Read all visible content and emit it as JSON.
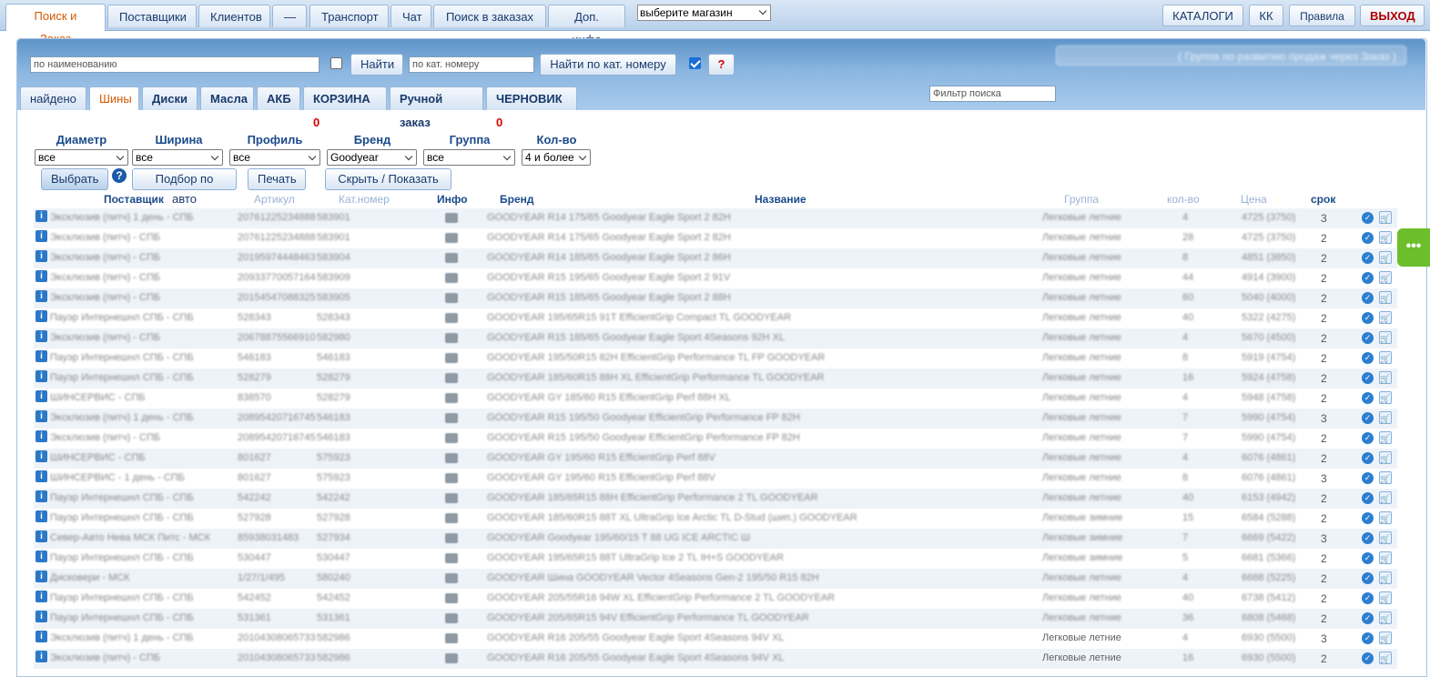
{
  "topnav": {
    "tabs": [
      "Поиск и Заказ",
      "Поставщики",
      "Клиентов",
      "—",
      "Транспорт",
      "Чат",
      "Поиск в заказах",
      "Доп. инфо"
    ],
    "store_select": "выберите магазин",
    "right_buttons": [
      "КАТАЛОГИ",
      "КК",
      "Правила"
    ],
    "exit": "ВЫХОД"
  },
  "search": {
    "name_placeholder": "по наименованию",
    "find_label": "Найти",
    "catno_placeholder": "по кат. номеру",
    "find_catno_label": "Найти по кат. номеру",
    "help_label": "?",
    "blurred_note": "( Группа по развитию продаж через Заказ )",
    "filter_placeholder": "Фильтр поиска"
  },
  "subtabs": {
    "found": "найдено",
    "tires": "Шины",
    "disks": "Диски",
    "oils": "Масла",
    "akb": "АКБ",
    "cart": "КОРЗИНА",
    "cart_count": "0",
    "manual": "Ручной заказ",
    "draft": "ЧЕРНОВИК",
    "draft_count": "0"
  },
  "filters": {
    "diameter": {
      "label": "Диаметр",
      "value": "все"
    },
    "width": {
      "label": "Ширина",
      "value": "все"
    },
    "profile": {
      "label": "Профиль",
      "value": "все"
    },
    "brand": {
      "label": "Бренд",
      "value": "Goodyear"
    },
    "group": {
      "label": "Группа",
      "value": "все"
    },
    "qty": {
      "label": "Кол-во",
      "value": "4 и более"
    },
    "select_button": "Выбрать",
    "auto_button": "Подбор по авто",
    "print_button": "Печать",
    "toggle_button": "Скрыть / Показать"
  },
  "table": {
    "headers": {
      "supplier": "Поставщик",
      "article": "Артикул",
      "catno": "Кат.номер",
      "info": "Инфо",
      "brand": "Бренд",
      "name": "Название",
      "group": "Группа",
      "qty": "кол-во",
      "price": "Цена",
      "srok": "срок"
    },
    "rows": [
      {
        "supplier": "Эксклюзив (питч) 1 день - СПБ",
        "article": "20761225234888",
        "catno": "583901",
        "name": "GOODYEAR R14 175/65 Goodyear Eagle Sport 2 82H",
        "group": "Легковые летние",
        "qty": "4",
        "price": "4725 (3750)",
        "srok": "3"
      },
      {
        "supplier": "Эксклюзив (питч) - СПБ",
        "article": "20761225234888",
        "catno": "583901",
        "name": "GOODYEAR R14 175/65 Goodyear Eagle Sport 2 82H",
        "group": "Легковые летние",
        "qty": "28",
        "price": "4725 (3750)",
        "srok": "2"
      },
      {
        "supplier": "Эксклюзив (питч) - СПБ",
        "article": "20195974448463",
        "catno": "583904",
        "name": "GOODYEAR R14 185/65 Goodyear Eagle Sport 2 86H",
        "group": "Легковые летние",
        "qty": "8",
        "price": "4851 (3850)",
        "srok": "2"
      },
      {
        "supplier": "Эксклюзив (питч) - СПБ",
        "article": "20933770057164",
        "catno": "583909",
        "name": "GOODYEAR R15 195/65 Goodyear Eagle Sport 2 91V",
        "group": "Легковые летние",
        "qty": "44",
        "price": "4914 (3900)",
        "srok": "2"
      },
      {
        "supplier": "Эксклюзив (питч) - СПБ",
        "article": "20154547088325",
        "catno": "583905",
        "name": "GOODYEAR R15 185/65 Goodyear Eagle Sport 2 88H",
        "group": "Легковые летние",
        "qty": "60",
        "price": "5040 (4000)",
        "srok": "2"
      },
      {
        "supplier": "Пауэр Интернешнл СПБ - СПБ",
        "article": "528343",
        "catno": "528343",
        "name": "GOODYEAR 195/65R15 91T EfficientGrip Compact TL GOODYEAR",
        "group": "Легковые летние",
        "qty": "40",
        "price": "5322 (4275)",
        "srok": "2"
      },
      {
        "supplier": "Эксклюзив (питч) - СПБ",
        "article": "20678875566910",
        "catno": "582980",
        "name": "GOODYEAR R15 185/65 Goodyear Eagle Sport 4Seasons 92H XL",
        "group": "Легковые летние",
        "qty": "4",
        "price": "5670 (4500)",
        "srok": "2"
      },
      {
        "supplier": "Пауэр Интернешнл СПБ - СПБ",
        "article": "546183",
        "catno": "546183",
        "name": "GOODYEAR 195/50R15 82H EfficientGrip Performance TL FP GOODYEAR",
        "group": "Легковые летние",
        "qty": "8",
        "price": "5919 (4754)",
        "srok": "2"
      },
      {
        "supplier": "Пауэр Интернешнл СПБ - СПБ",
        "article": "528279",
        "catno": "528279",
        "name": "GOODYEAR 185/60R15 88H XL EfficientGrip Performance TL GOODYEAR",
        "group": "Легковые летние",
        "qty": "16",
        "price": "5924 (4758)",
        "srok": "2"
      },
      {
        "supplier": "ШИНСЕРВИС - СПБ",
        "article": "838570",
        "catno": "528279",
        "name": "GOODYEAR GY 185/60 R15 EfficientGrip Perf 88H XL",
        "group": "Легковые летние",
        "qty": "4",
        "price": "5948 (4758)",
        "srok": "2"
      },
      {
        "supplier": "Эксклюзив (питч) 1 день - СПБ",
        "article": "20895420716745",
        "catno": "546183",
        "name": "GOODYEAR R15 195/50 Goodyear EfficientGrip Performance FP 82H",
        "group": "Легковые летние",
        "qty": "7",
        "price": "5990 (4754)",
        "srok": "3"
      },
      {
        "supplier": "Эксклюзив (питч) - СПБ",
        "article": "20895420716745",
        "catno": "546183",
        "name": "GOODYEAR R15 195/50 Goodyear EfficientGrip Performance FP 82H",
        "group": "Легковые летние",
        "qty": "7",
        "price": "5990 (4754)",
        "srok": "2"
      },
      {
        "supplier": "ШИНСЕРВИС - СПБ",
        "article": "801627",
        "catno": "575923",
        "name": "GOODYEAR GY 195/60 R15 EfficientGrip Perf 88V",
        "group": "Легковые летние",
        "qty": "4",
        "price": "6076 (4861)",
        "srok": "2"
      },
      {
        "supplier": "ШИНСЕРВИС - 1 день - СПБ",
        "article": "801627",
        "catno": "575923",
        "name": "GOODYEAR GY 195/60 R15 EfficientGrip Perf 88V",
        "group": "Легковые летние",
        "qty": "8",
        "price": "6076 (4861)",
        "srok": "3"
      },
      {
        "supplier": "Пауэр Интернешнл СПБ - СПБ",
        "article": "542242",
        "catno": "542242",
        "name": "GOODYEAR 185/65R15 88H EfficientGrip Performance 2 TL GOODYEAR",
        "group": "Легковые летние",
        "qty": "40",
        "price": "6153 (4942)",
        "srok": "2"
      },
      {
        "supplier": "Пауэр Интернешнл СПБ - СПБ",
        "article": "527928",
        "catno": "527928",
        "name": "GOODYEAR 185/60R15 88T XL UltraGrip Ice Arctic TL D-Stud (шип.) GOODYEAR",
        "group": "Легковые зимние",
        "qty": "15",
        "price": "6584 (5288)",
        "srok": "2"
      },
      {
        "supplier": "Север-Авто Нева МСК Питс - МСК",
        "article": "85938031483",
        "catno": "527934",
        "name": "GOODYEAR Goodyear 195/60/15 T 88 UG ICE ARCTIC Ш",
        "group": "Легковые зимние",
        "qty": "7",
        "price": "6669 (5422)",
        "srok": "3"
      },
      {
        "supplier": "Пауэр Интернешнл СПБ - СПБ",
        "article": "530447",
        "catno": "530447",
        "name": "GOODYEAR 195/65R15 88T UltraGrip Ice 2 TL IH+S GOODYEAR",
        "group": "Легковые зимние",
        "qty": "5",
        "price": "6681 (5366)",
        "srok": "2"
      },
      {
        "supplier": "Дисковери - МСК",
        "article": "1/27/1/495",
        "catno": "580240",
        "name": "GOODYEAR Шина GOODYEAR Vector 4Seasons Gen-2 195/50 R15 82H",
        "group": "Легковые летние",
        "qty": "4",
        "price": "6688 (5225)",
        "srok": "2"
      },
      {
        "supplier": "Пауэр Интернешнл СПБ - СПБ",
        "article": "542452",
        "catno": "542452",
        "name": "GOODYEAR 205/55R16 94W XL EfficientGrip Performance 2 TL GOODYEAR",
        "group": "Легковые летние",
        "qty": "40",
        "price": "6738 (5412)",
        "srok": "2"
      },
      {
        "supplier": "Пауэр Интернешнл СПБ - СПБ",
        "article": "531361",
        "catno": "531361",
        "name": "GOODYEAR 205/65R15 94V EfficientGrip Performance TL GOODYEAR",
        "group": "Легковые летние",
        "qty": "36",
        "price": "6808 (5468)",
        "srok": "2"
      },
      {
        "supplier": "Эксклюзив (питч) 1 день - СПБ",
        "article": "20104308065733",
        "catno": "582986",
        "name": "GOODYEAR R16 205/55 Goodyear Eagle Sport 4Seasons 94V XL",
        "group": "Легковые летние",
        "qty": "4",
        "price": "6930 (5500)",
        "srok": "3"
      },
      {
        "supplier": "Эксклюзив (питч) - СПБ",
        "article": "20104308065733",
        "catno": "582986",
        "name": "GOODYEAR R16 205/55 Goodyear Eagle Sport 4Seasons 94V XL",
        "group": "Легковые летние",
        "qty": "16",
        "price": "6930 (5500)",
        "srok": "2"
      }
    ]
  },
  "side_handle": "•••"
}
